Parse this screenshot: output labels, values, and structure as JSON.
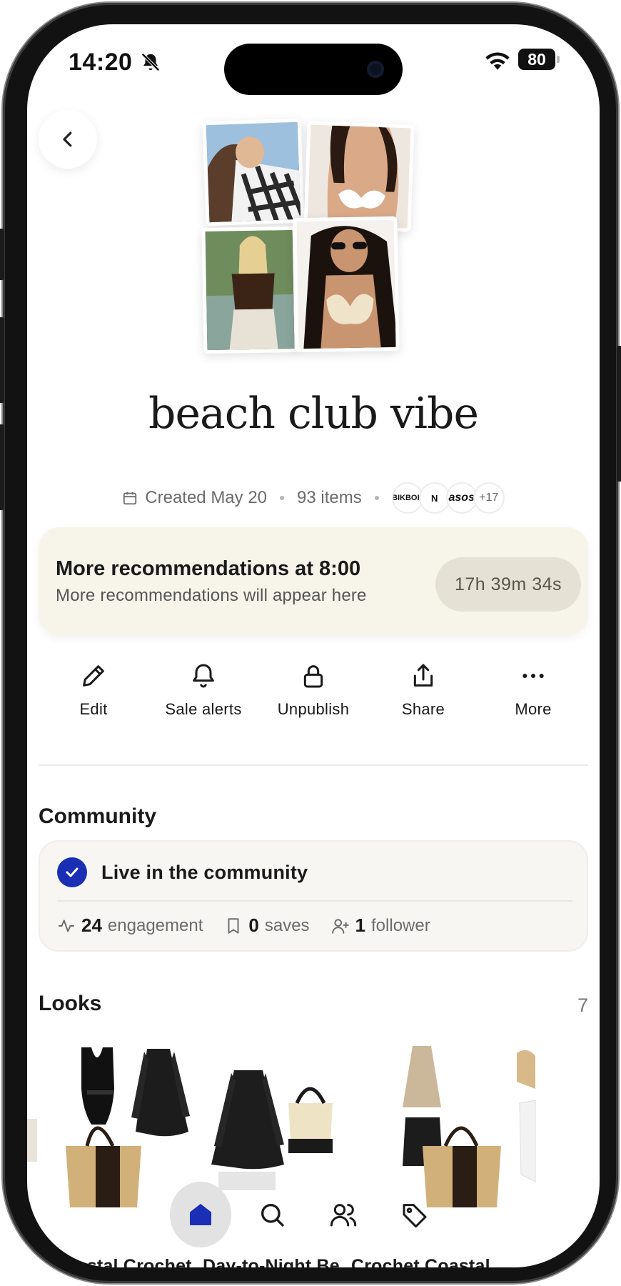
{
  "status_bar": {
    "time": "14:20",
    "battery": "80",
    "icons": [
      "bell-off-icon",
      "wifi-icon",
      "battery-icon"
    ]
  },
  "header": {
    "back_icon": "chevron-left-icon"
  },
  "board": {
    "title": "beach club vibe",
    "created": "Created May 20",
    "items": "93 items",
    "brands": [
      "BIKBOK",
      "N",
      "asos"
    ],
    "brands_more": "+17"
  },
  "recommendations": {
    "title": "More recommendations at 8:00",
    "subtitle": "More recommendations will appear here",
    "countdown": "17h 39m 34s"
  },
  "actions": [
    {
      "label": "Edit",
      "icon": "pencil-icon"
    },
    {
      "label": "Sale alerts",
      "icon": "bell-icon"
    },
    {
      "label": "Unpublish",
      "icon": "lock-icon"
    },
    {
      "label": "Share",
      "icon": "share-icon"
    },
    {
      "label": "More",
      "icon": "more-icon"
    }
  ],
  "community": {
    "heading": "Community",
    "status": "Live in the community",
    "engagement_value": "24",
    "engagement_label": "engagement",
    "saves_value": "0",
    "saves_label": "saves",
    "followers_value": "1",
    "followers_label": "follower"
  },
  "looks": {
    "heading": "Looks",
    "count": "7",
    "items": [
      {
        "name": "Coastal Crochet..."
      },
      {
        "name": "Day-to-Night Be..."
      },
      {
        "name": "Crochet Coastal..."
      }
    ]
  },
  "tab_bar": {
    "tabs": [
      "home-icon",
      "search-icon",
      "people-icon",
      "tag-icon"
    ],
    "active": "home-icon"
  },
  "colors": {
    "accent": "#1a2fb5",
    "banner_bg": "#f7f4e9",
    "timer_bg": "#e6e1d5",
    "card_bg": "#f7f6f3"
  }
}
